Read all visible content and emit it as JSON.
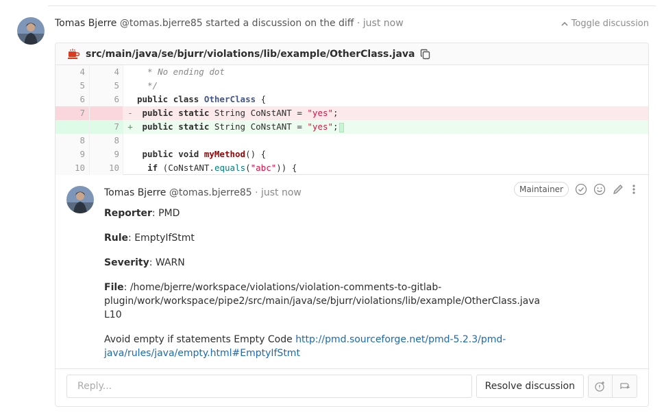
{
  "discussion": {
    "author": "Tomas Bjerre",
    "handle": "@tomas.bjerre85",
    "action": "started a discussion on the diff",
    "separator": "·",
    "time": "just now",
    "toggle_label": "Toggle discussion",
    "avatar_icon": "user-avatar"
  },
  "file": {
    "icon": "file-coffee-icon",
    "path": "src/main/java/se/bjurr/violations/lib/example/OtherClass.java",
    "copy_icon": "copy-icon"
  },
  "diff": {
    "lines": [
      {
        "old": "4",
        "new": "4",
        "type": "context",
        "sign": " ",
        "text": "  * No ending dot"
      },
      {
        "old": "5",
        "new": "5",
        "type": "context",
        "sign": " ",
        "text": "  */"
      },
      {
        "old": "6",
        "new": "6",
        "type": "context",
        "sign": " ",
        "text": "public class OtherClass {"
      },
      {
        "old": "7",
        "new": "",
        "type": "old",
        "sign": "-",
        "text": " public static String CoNstANT = \"yes\";"
      },
      {
        "old": "",
        "new": "7",
        "type": "new",
        "sign": "+",
        "text": " public static String CoNstANT = \"yes\";"
      },
      {
        "old": "8",
        "new": "8",
        "type": "context",
        "sign": " ",
        "text": ""
      },
      {
        "old": "9",
        "new": "9",
        "type": "context",
        "sign": " ",
        "text": " public void myMethod() {"
      },
      {
        "old": "10",
        "new": "10",
        "type": "context",
        "sign": " ",
        "text": "  if (CoNstANT.equals(\"abc\")) {"
      }
    ]
  },
  "note": {
    "author": "Tomas Bjerre",
    "handle": "@tomas.bjerre85",
    "separator": "·",
    "time": "just now",
    "badge": "Maintainer",
    "actions": [
      "resolve-check-icon",
      "smiley-icon",
      "pencil-icon",
      "more-vertical-icon"
    ],
    "reporter_label": "Reporter",
    "reporter_value": ": PMD",
    "rule_label": "Rule",
    "rule_value": ": EmptyIfStmt",
    "severity_label": "Severity",
    "severity_value": ": WARN",
    "file_label": "File",
    "file_value": ": /home/bjerre/workspace/violations/violation-comments-to-gitlab-plugin/work/workspace/pipe2/src/main/java/se/bjurr/violations/lib/example/OtherClass.java L10",
    "message": "Avoid empty if statements Empty Code ",
    "link": "http://pmd.sourceforge.net/pmd-5.2.3/pmd-java/rules/java/empty.html#EmptyIfStmt"
  },
  "reply": {
    "placeholder": "Reply...",
    "resolve_label": "Resolve discussion",
    "icons": [
      "resolve-issue-icon",
      "jump-to-next-icon"
    ]
  },
  "colors": {
    "link": "#1b69b6",
    "removed_bg": "#fbe9eb",
    "added_bg": "#ecfdf0",
    "file_icon": "#db3b21"
  }
}
